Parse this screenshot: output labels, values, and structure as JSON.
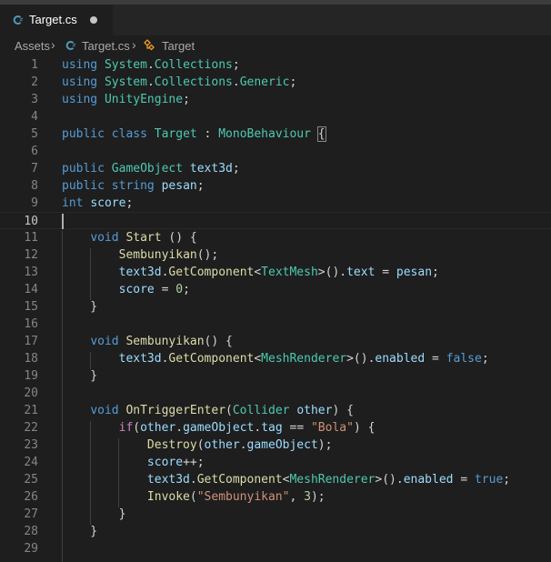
{
  "tab": {
    "label": "Target.cs",
    "modified": true
  },
  "breadcrumb": {
    "folder": "Assets",
    "file": "Target.cs",
    "symbol": "Target"
  },
  "lines": [
    [
      [
        "kw",
        "using"
      ],
      [
        "",
        " "
      ],
      [
        "ns",
        "System"
      ],
      [
        "",
        "."
      ],
      [
        "ns",
        "Collections"
      ],
      [
        "",
        ";"
      ]
    ],
    [
      [
        "kw",
        "using"
      ],
      [
        "",
        " "
      ],
      [
        "ns",
        "System"
      ],
      [
        "",
        "."
      ],
      [
        "ns",
        "Collections"
      ],
      [
        "",
        "."
      ],
      [
        "ns",
        "Generic"
      ],
      [
        "",
        ";"
      ]
    ],
    [
      [
        "kw",
        "using"
      ],
      [
        "",
        " "
      ],
      [
        "ns",
        "UnityEngine"
      ],
      [
        "",
        ";"
      ]
    ],
    [],
    [
      [
        "kw",
        "public"
      ],
      [
        "",
        " "
      ],
      [
        "kw",
        "class"
      ],
      [
        "",
        " "
      ],
      [
        "ty",
        "Target"
      ],
      [
        "",
        " : "
      ],
      [
        "ty",
        "MonoBehaviour"
      ],
      [
        "",
        " "
      ],
      [
        "bm",
        "{"
      ]
    ],
    [],
    [
      [
        "kw",
        "public"
      ],
      [
        "",
        " "
      ],
      [
        "ty",
        "GameObject"
      ],
      [
        "",
        " "
      ],
      [
        "vr",
        "text3d"
      ],
      [
        "",
        ";"
      ]
    ],
    [
      [
        "kw",
        "public"
      ],
      [
        "",
        " "
      ],
      [
        "kw",
        "string"
      ],
      [
        "",
        " "
      ],
      [
        "vr",
        "pesan"
      ],
      [
        "",
        ";"
      ]
    ],
    [
      [
        "kw",
        "int"
      ],
      [
        "",
        " "
      ],
      [
        "vr",
        "score"
      ],
      [
        "",
        ";"
      ]
    ],
    [],
    [
      [
        "",
        "    "
      ],
      [
        "kw",
        "void"
      ],
      [
        "",
        " "
      ],
      [
        "fn",
        "Start"
      ],
      [
        "",
        " () {"
      ]
    ],
    [
      [
        "",
        "        "
      ],
      [
        "fn",
        "Sembunyikan"
      ],
      [
        "",
        "();"
      ]
    ],
    [
      [
        "",
        "        "
      ],
      [
        "vr",
        "text3d"
      ],
      [
        "",
        "."
      ],
      [
        "fn",
        "GetComponent"
      ],
      [
        "",
        "<"
      ],
      [
        "ty",
        "TextMesh"
      ],
      [
        "",
        ">()."
      ],
      [
        "vr",
        "text"
      ],
      [
        "",
        " = "
      ],
      [
        "vr",
        "pesan"
      ],
      [
        "",
        ";"
      ]
    ],
    [
      [
        "",
        "        "
      ],
      [
        "vr",
        "score"
      ],
      [
        "",
        " = "
      ],
      [
        "nm",
        "0"
      ],
      [
        "",
        ";"
      ]
    ],
    [
      [
        "",
        "    }"
      ]
    ],
    [],
    [
      [
        "",
        "    "
      ],
      [
        "kw",
        "void"
      ],
      [
        "",
        " "
      ],
      [
        "fn",
        "Sembunyikan"
      ],
      [
        "",
        "() {"
      ]
    ],
    [
      [
        "",
        "        "
      ],
      [
        "vr",
        "text3d"
      ],
      [
        "",
        "."
      ],
      [
        "fn",
        "GetComponent"
      ],
      [
        "",
        "<"
      ],
      [
        "ty",
        "MeshRenderer"
      ],
      [
        "",
        ">()."
      ],
      [
        "vr",
        "enabled"
      ],
      [
        "",
        " = "
      ],
      [
        "kw",
        "false"
      ],
      [
        "",
        ";"
      ]
    ],
    [
      [
        "",
        "    }"
      ]
    ],
    [],
    [
      [
        "",
        "    "
      ],
      [
        "kw",
        "void"
      ],
      [
        "",
        " "
      ],
      [
        "fn",
        "OnTriggerEnter"
      ],
      [
        "",
        "("
      ],
      [
        "ty",
        "Collider"
      ],
      [
        "",
        " "
      ],
      [
        "vr",
        "other"
      ],
      [
        "",
        ") {"
      ]
    ],
    [
      [
        "",
        "        "
      ],
      [
        "ctl",
        "if"
      ],
      [
        "",
        "("
      ],
      [
        "vr",
        "other"
      ],
      [
        "",
        "."
      ],
      [
        "vr",
        "gameObject"
      ],
      [
        "",
        "."
      ],
      [
        "vr",
        "tag"
      ],
      [
        "",
        " == "
      ],
      [
        "st",
        "\"Bola\""
      ],
      [
        "",
        ") {"
      ]
    ],
    [
      [
        "",
        "            "
      ],
      [
        "fn",
        "Destroy"
      ],
      [
        "",
        "("
      ],
      [
        "vr",
        "other"
      ],
      [
        "",
        "."
      ],
      [
        "vr",
        "gameObject"
      ],
      [
        "",
        ");"
      ]
    ],
    [
      [
        "",
        "            "
      ],
      [
        "vr",
        "score"
      ],
      [
        "",
        "++;"
      ]
    ],
    [
      [
        "",
        "            "
      ],
      [
        "vr",
        "text3d"
      ],
      [
        "",
        "."
      ],
      [
        "fn",
        "GetComponent"
      ],
      [
        "",
        "<"
      ],
      [
        "ty",
        "MeshRenderer"
      ],
      [
        "",
        ">()."
      ],
      [
        "vr",
        "enabled"
      ],
      [
        "",
        " = "
      ],
      [
        "kw",
        "true"
      ],
      [
        "",
        ";"
      ]
    ],
    [
      [
        "",
        "            "
      ],
      [
        "fn",
        "Invoke"
      ],
      [
        "",
        "("
      ],
      [
        "st",
        "\"Sembunyikan\""
      ],
      [
        "",
        ", "
      ],
      [
        "nm",
        "3"
      ],
      [
        "",
        ");"
      ]
    ],
    [
      [
        "",
        "        }"
      ]
    ],
    [
      [
        "",
        "    }"
      ]
    ],
    []
  ],
  "active_line": 10
}
